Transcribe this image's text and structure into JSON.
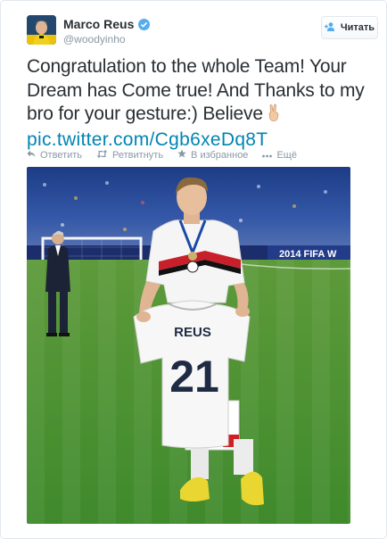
{
  "user": {
    "name": "Marco Reus",
    "handle": "@woodyinho"
  },
  "follow_button": {
    "label": "Читать"
  },
  "tweet": {
    "text_line1": "Congratulation to the whole Team! Your",
    "text_line2": "Dream has Come true! And Thanks to my",
    "text_line3": "bro for your gesture:) Believe",
    "link": "pic.twitter.com/Cgb6xeDq8T"
  },
  "actions": [
    {
      "label": "Ответить",
      "icon": "reply-icon"
    },
    {
      "label": "Ретвитнуть",
      "icon": "retweet-icon"
    },
    {
      "label": "В избранное",
      "icon": "star-icon"
    },
    {
      "label": "Ещё",
      "icon": "more-icon"
    }
  ],
  "photo": {
    "jersey_name": "REUS",
    "jersey_number": "21",
    "ad_board_text": "2014 FIFA W"
  },
  "colors": {
    "link": "#0084b4",
    "verified": "#55acee",
    "muted": "#8899a6",
    "pitch": "#3f8a2c"
  }
}
